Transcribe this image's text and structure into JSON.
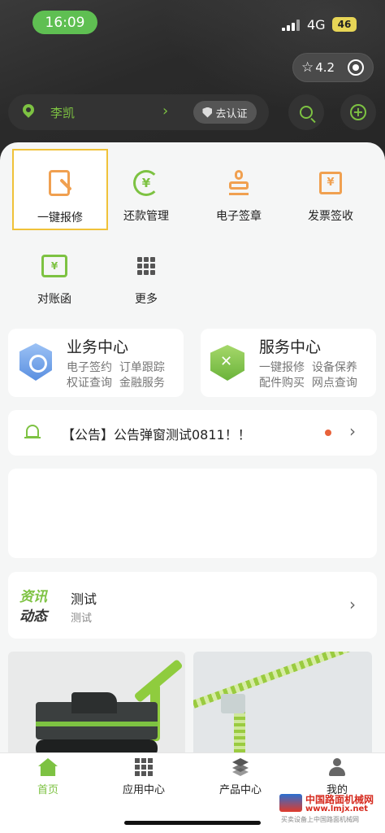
{
  "status_bar": {
    "time": "16:09",
    "network": "4G",
    "battery": "46"
  },
  "capsule": {
    "rating": "4.2"
  },
  "user": {
    "name": "李凯",
    "verify_label": "去认证"
  },
  "quick_actions": [
    {
      "label": "一键报修",
      "icon": "repair-icon"
    },
    {
      "label": "还款管理",
      "icon": "repayment-icon"
    },
    {
      "label": "电子签章",
      "icon": "stamp-icon"
    },
    {
      "label": "发票签收",
      "icon": "invoice-icon"
    },
    {
      "label": "对账函",
      "icon": "statement-icon"
    },
    {
      "label": "更多",
      "icon": "grid-icon"
    }
  ],
  "business_card": {
    "title": "业务中心",
    "items": [
      "电子签约",
      "订单跟踪",
      "权证查询",
      "金融服务"
    ]
  },
  "service_card": {
    "title": "服务中心",
    "items": [
      "一键报修",
      "设备保养",
      "配件购买",
      "网点查询"
    ]
  },
  "notice": {
    "text": "【公告】公告弹窗测试0811！！"
  },
  "news": {
    "logo_top": "资讯",
    "logo_bottom": "动态",
    "title": "测试",
    "subtitle": "测试"
  },
  "tabs": [
    {
      "label": "首页",
      "active": true
    },
    {
      "label": "应用中心",
      "active": false
    },
    {
      "label": "产品中心",
      "active": false
    },
    {
      "label": "我的",
      "active": false
    }
  ],
  "watermark": {
    "line1": "中国路面机械网",
    "line2": "www.lmjx.net",
    "line3": "买卖设备上中国路面机械网"
  },
  "colors": {
    "accent": "#7dc242",
    "highlight": "#f0c239",
    "dark_header": "#2a2a2a"
  }
}
